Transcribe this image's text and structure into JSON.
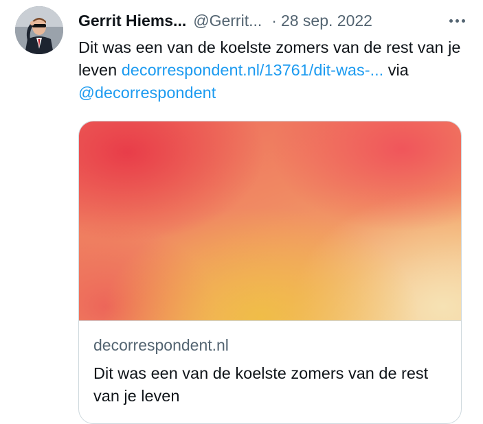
{
  "author": {
    "display_name": "Gerrit Hiems...",
    "handle": "@Gerrit...",
    "separator": "·",
    "date": "28 sep. 2022"
  },
  "tweet": {
    "text_part1": "Dit was een van de koelste zomers van de rest van je leven ",
    "link": "decorrespondent.nl/13761/dit-was-...",
    "text_part2": " via ",
    "mention": "@decorrespondent"
  },
  "card": {
    "domain": "decorrespondent.nl",
    "title": "Dit was een van de koelste zomers van de rest van je leven"
  },
  "icons": {
    "more": "more-horizontal-icon",
    "avatar": "avatar-photo"
  },
  "colors": {
    "link": "#1d9bf0",
    "secondary_text": "#536471",
    "primary_text": "#0f1419",
    "border": "#cfd9de"
  }
}
